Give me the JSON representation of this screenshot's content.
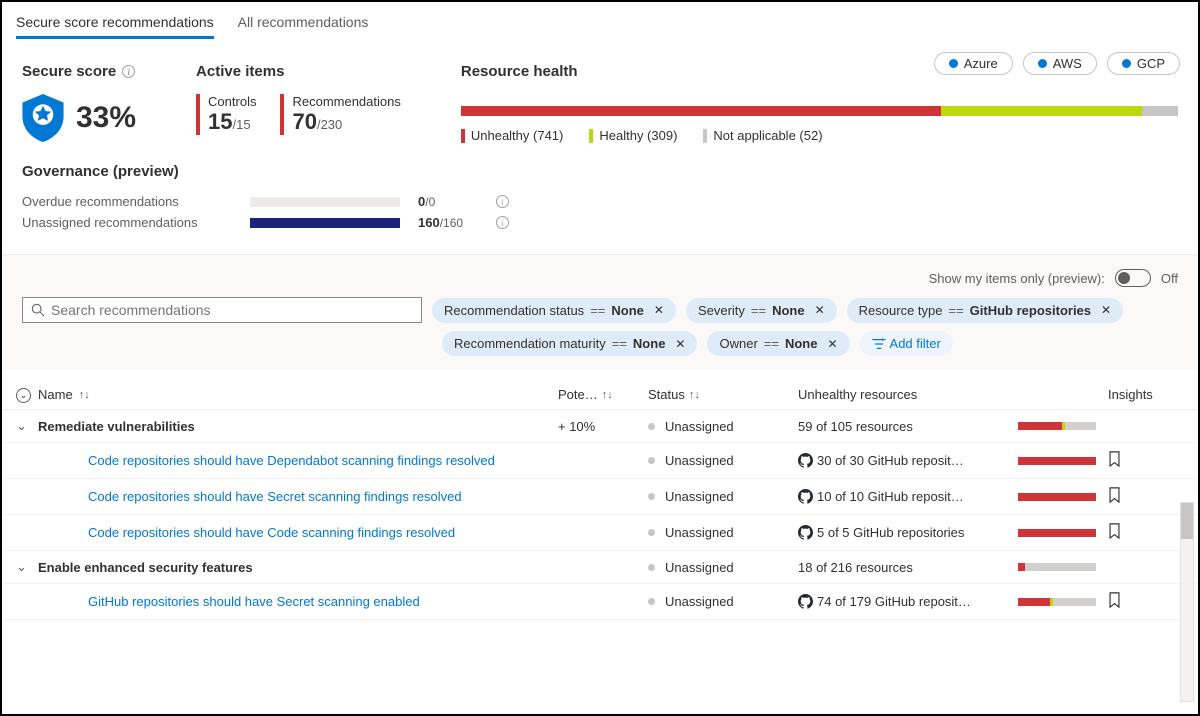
{
  "tabs": {
    "secure": "Secure score recommendations",
    "all": "All recommendations"
  },
  "clouds": [
    "Azure",
    "AWS",
    "GCP"
  ],
  "secureScore": {
    "title": "Secure score",
    "value": "33%"
  },
  "activeItems": {
    "title": "Active items",
    "controls": {
      "label": "Controls",
      "num": "15",
      "total": "/15"
    },
    "recs": {
      "label": "Recommendations",
      "num": "70",
      "total": "/230"
    }
  },
  "resourceHealth": {
    "title": "Resource health",
    "unhealthy": {
      "label": "Unhealthy (741)",
      "color": "#d13438",
      "width": 67
    },
    "healthy": {
      "label": "Healthy (309)",
      "color": "#bad80a",
      "width": 28
    },
    "na": {
      "label": "Not applicable (52)",
      "color": "#c8c6c4",
      "width": 5
    }
  },
  "governance": {
    "title": "Governance (preview)",
    "rows": [
      {
        "label": "Overdue recommendations",
        "num": "0",
        "total": "/0",
        "fill": 0
      },
      {
        "label": "Unassigned recommendations",
        "num": "160",
        "total": "/160",
        "fill": 100
      }
    ]
  },
  "showOnly": {
    "label": "Show my items only (preview):",
    "state": "Off"
  },
  "search": {
    "placeholder": "Search recommendations"
  },
  "filters": {
    "recStatus": {
      "label": "Recommendation status",
      "value": "None"
    },
    "severity": {
      "label": "Severity",
      "value": "None"
    },
    "resourceType": {
      "label": "Resource type",
      "value": "GitHub repositories"
    },
    "recMaturity": {
      "label": "Recommendation maturity",
      "value": "None"
    },
    "owner": {
      "label": "Owner",
      "value": "None"
    },
    "add": "Add filter"
  },
  "columns": {
    "name": "Name",
    "pot": "Pote…",
    "status": "Status",
    "unh": "Unhealthy resources",
    "ins": "Insights"
  },
  "rows": [
    {
      "type": "group",
      "name": "Remediate vulnerabilities",
      "pot": "+ 10%",
      "status": "Unassigned",
      "unh": "59 of 105 resources",
      "bar": {
        "red": 56,
        "green": 4,
        "grey": 40
      }
    },
    {
      "type": "child",
      "name": "Code repositories should have Dependabot scanning findings resolved",
      "status": "Unassigned",
      "gh": true,
      "unh": "30 of 30 GitHub reposit…",
      "bar": {
        "red": 100
      },
      "insight": true
    },
    {
      "type": "child",
      "name": "Code repositories should have Secret scanning findings resolved",
      "status": "Unassigned",
      "gh": true,
      "unh": "10 of 10 GitHub reposit…",
      "bar": {
        "red": 100
      },
      "insight": true
    },
    {
      "type": "child",
      "name": "Code repositories should have Code scanning findings resolved",
      "status": "Unassigned",
      "gh": true,
      "unh": "5 of 5 GitHub repositories",
      "bar": {
        "red": 100
      },
      "insight": true
    },
    {
      "type": "group",
      "name": "Enable enhanced security features",
      "status": "Unassigned",
      "unh": "18 of 216 resources",
      "bar": {
        "red": 9,
        "grey": 91
      }
    },
    {
      "type": "child",
      "name": "GitHub repositories should have Secret scanning enabled",
      "status": "Unassigned",
      "gh": true,
      "unh": "74 of 179 GitHub reposit…",
      "bar": {
        "red": 41,
        "green": 4,
        "grey": 55
      },
      "insight": true
    }
  ]
}
